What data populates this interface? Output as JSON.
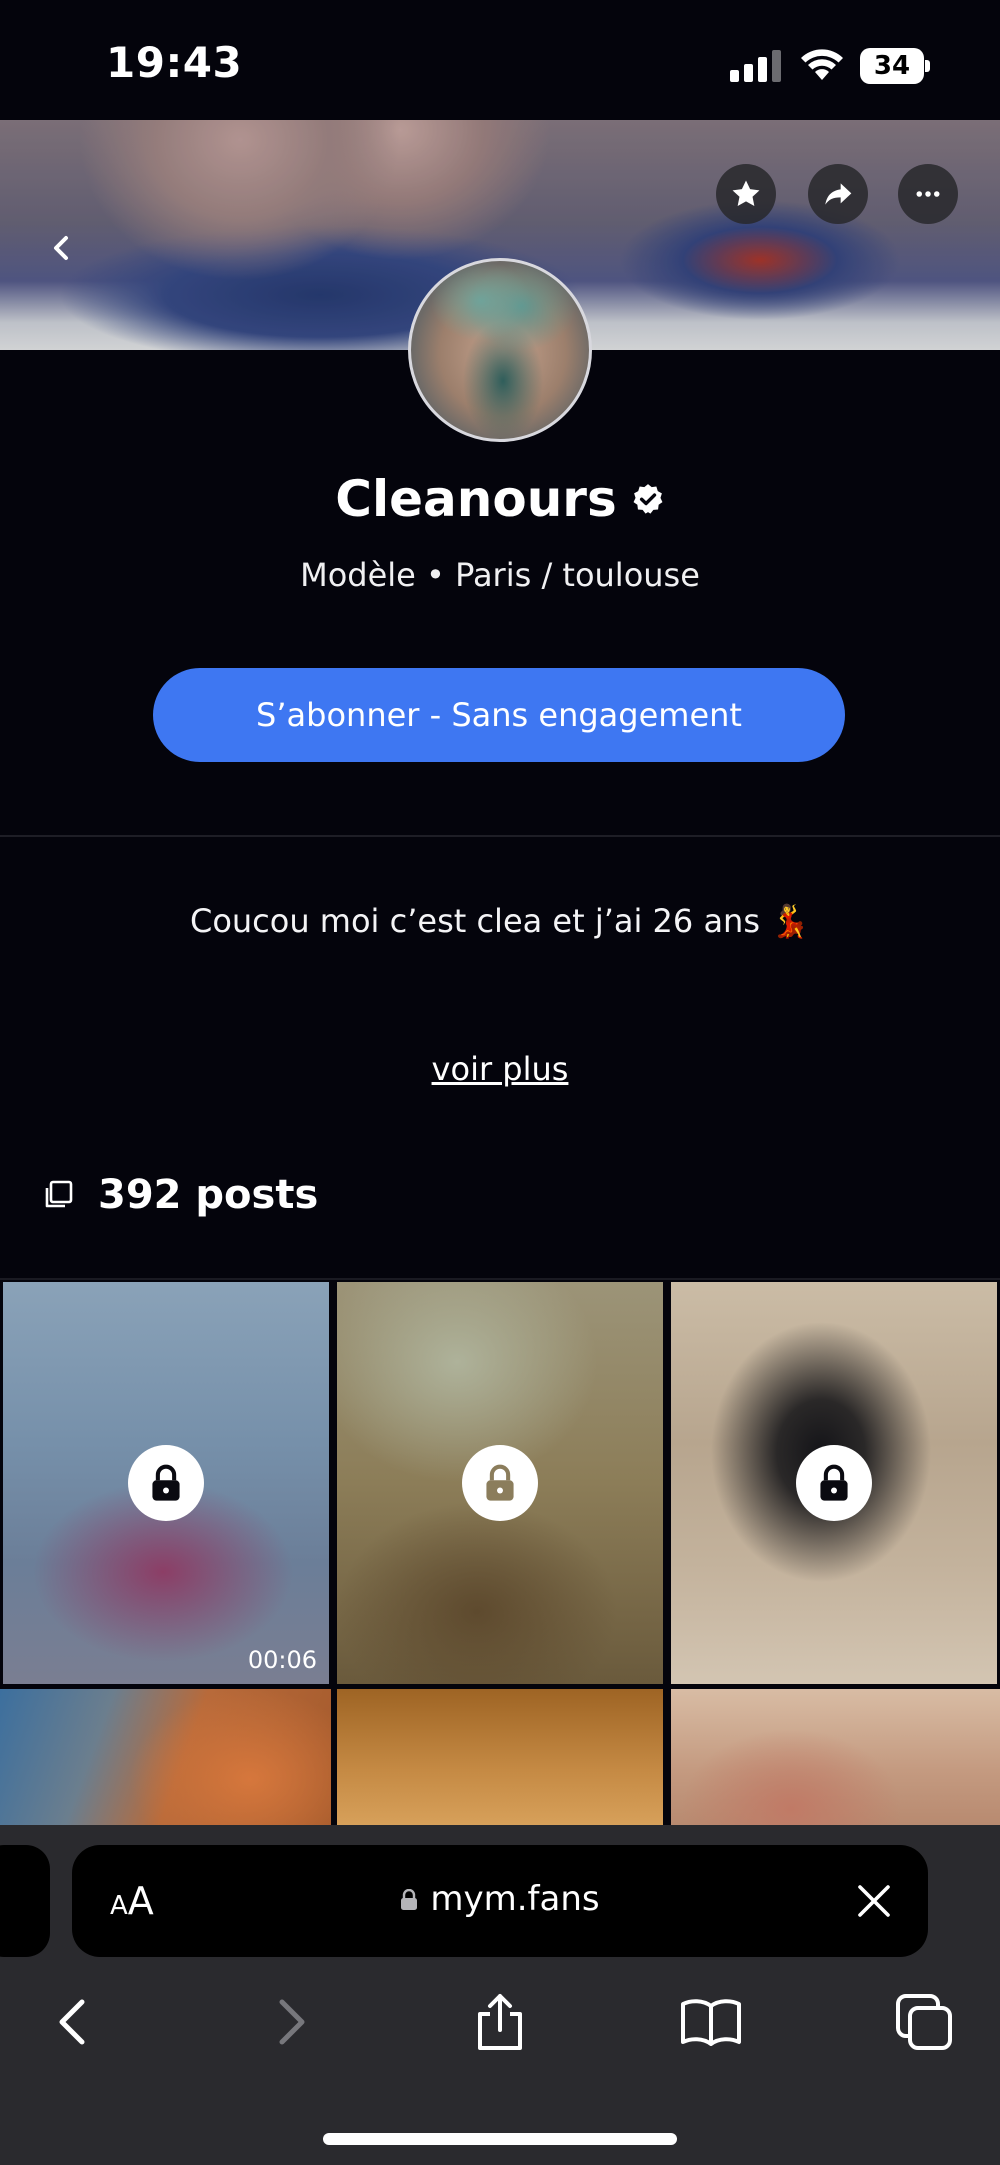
{
  "status_bar": {
    "time": "19:43",
    "battery": "34"
  },
  "profile": {
    "name": "Cleanours",
    "subtitle": "Modèle • Paris / toulouse",
    "subscribe_label": "S’abonner - Sans engagement",
    "bio": "Coucou moi c’est clea et j’ai 26 ans 💃",
    "more_label": "voir plus",
    "posts_count": "392 posts"
  },
  "cover_actions": [
    "star-icon",
    "share-icon",
    "more-icon"
  ],
  "grid": {
    "tiles": [
      {
        "locked": true,
        "duration": "00:06"
      },
      {
        "locked": true,
        "duration": ""
      },
      {
        "locked": true,
        "duration": ""
      },
      {
        "locked": false,
        "duration": ""
      },
      {
        "locked": false,
        "duration": ""
      },
      {
        "locked": false,
        "duration": ""
      }
    ]
  },
  "browser": {
    "text_size_label_small": "A",
    "text_size_label_large": "A",
    "url": "mym.fans"
  },
  "colors": {
    "accent": "#3e77f2",
    "background": "#04040c",
    "safari_bar": "#2a2a2e"
  }
}
